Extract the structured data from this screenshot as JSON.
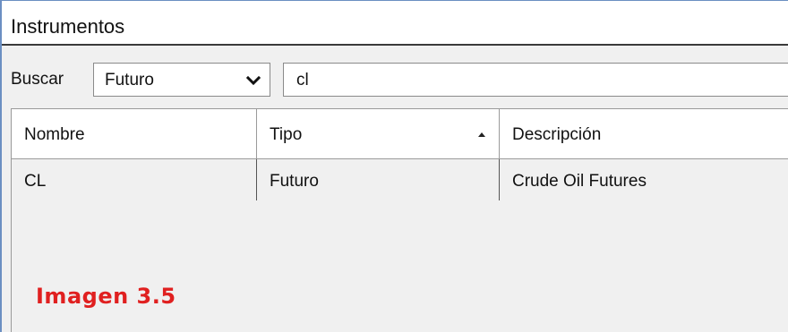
{
  "window": {
    "title": "Instrumentos"
  },
  "toolbar": {
    "search_label": "Buscar",
    "type_select": {
      "value": "Futuro"
    },
    "search_input": {
      "value": "cl"
    }
  },
  "table": {
    "columns": [
      "Nombre",
      "Tipo",
      "Descripción"
    ],
    "sorted_column": "Tipo",
    "sort_direction": "ascending",
    "rows": [
      {
        "nombre": "CL",
        "tipo": "Futuro",
        "descripcion": "Crude Oil Futures"
      }
    ]
  },
  "caption": "Imagen 3.5",
  "colors": {
    "caption": "#e02020",
    "frame_border": "#6b8fc2"
  },
  "icons": {
    "select": "chevron-down-icon",
    "sort": "sort-ascending-icon"
  }
}
